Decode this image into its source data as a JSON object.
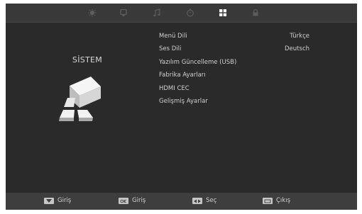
{
  "tabs": [
    {
      "icon": "picture-icon"
    },
    {
      "icon": "sound-icon"
    },
    {
      "icon": "music-note-icon"
    },
    {
      "icon": "timer-icon"
    },
    {
      "icon": "system-grid-icon",
      "active": true
    },
    {
      "icon": "lock-icon"
    }
  ],
  "section": {
    "title": "SİSTEM",
    "icon": "system-cubes-icon"
  },
  "menu": {
    "items": [
      {
        "label": "Menü Dili",
        "value": "Türkçe"
      },
      {
        "label": "Ses Dili",
        "value": "Deutsch"
      },
      {
        "label": "Yazılım Güncelleme (USB)"
      },
      {
        "label": "Fabrika Ayarları"
      },
      {
        "label": "HDMI CEC"
      },
      {
        "label": "Gelişmiş Ayarlar"
      }
    ]
  },
  "footer": {
    "hints": [
      {
        "key": "down-key-icon",
        "label": "Giriş"
      },
      {
        "key": "ok-key-icon",
        "label": "Giriş"
      },
      {
        "key": "left-right-key-icon",
        "label": "Seç"
      },
      {
        "key": "exit-key-icon",
        "label": "Çıkış"
      }
    ]
  },
  "colors": {
    "background": "#2a2a2a",
    "topbar": "#393939",
    "bottombar": "#3e3e3e",
    "text": "#d0d0d0",
    "active_tab": "#ffffff",
    "inactive_tab": "#5c5c5c"
  }
}
